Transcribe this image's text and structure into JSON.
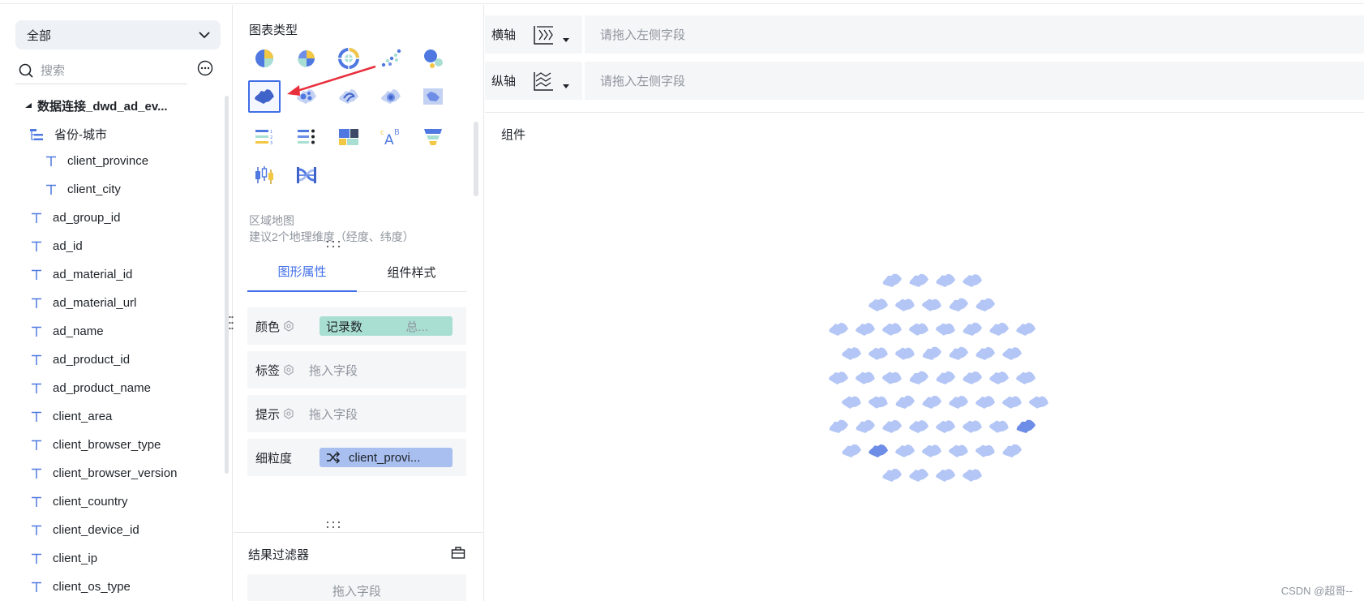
{
  "left_panel": {
    "scope_value": "全部",
    "search_placeholder": "搜索",
    "tree": [
      {
        "label": "数据连接_dwd_ad_ev...",
        "kind": "root"
      },
      {
        "label": "省份-城市",
        "kind": "hierarchy"
      },
      {
        "label": "client_province",
        "kind": "child"
      },
      {
        "label": "client_city",
        "kind": "child"
      },
      {
        "label": "ad_group_id",
        "kind": "field"
      },
      {
        "label": "ad_id",
        "kind": "field"
      },
      {
        "label": "ad_material_id",
        "kind": "field"
      },
      {
        "label": "ad_material_url",
        "kind": "field"
      },
      {
        "label": "ad_name",
        "kind": "field"
      },
      {
        "label": "ad_product_id",
        "kind": "field"
      },
      {
        "label": "ad_product_name",
        "kind": "field"
      },
      {
        "label": "client_area",
        "kind": "field"
      },
      {
        "label": "client_browser_type",
        "kind": "field"
      },
      {
        "label": "client_browser_version",
        "kind": "field"
      },
      {
        "label": "client_country",
        "kind": "field"
      },
      {
        "label": "client_device_id",
        "kind": "field"
      },
      {
        "label": "client_ip",
        "kind": "field"
      },
      {
        "label": "client_os_type",
        "kind": "field"
      }
    ]
  },
  "middle_panel": {
    "chart_types_title": "图表类型",
    "selected_chart_name": "区域地图",
    "selected_chart_hint": "建议2个地理维度（经度、纬度）",
    "tabs": [
      "图形属性",
      "组件样式"
    ],
    "properties": [
      {
        "name": "颜色",
        "pill": "记录数",
        "pill_sub": "总...",
        "pill_color": "#a9dfd3"
      },
      {
        "name": "标签",
        "placeholder": "拖入字段"
      },
      {
        "name": "提示",
        "placeholder": "拖入字段"
      },
      {
        "name": "细粒度",
        "pill": "client_provi...",
        "pill_color": "#a8bfef"
      }
    ],
    "filter_title": "结果过滤器",
    "filter_placeholder": "拖入字段"
  },
  "canvas": {
    "x_axis_label": "横轴",
    "y_axis_label": "纵轴",
    "axis_placeholder": "请拖入左侧字段",
    "component_title": "组件",
    "watermark": "CSDN @超哥--"
  },
  "colors": {
    "accent": "#3f6ee6",
    "map_light": "#b3c6f5",
    "map_dark": "#6e8de6",
    "panel_bg": "#f5f6f8"
  }
}
